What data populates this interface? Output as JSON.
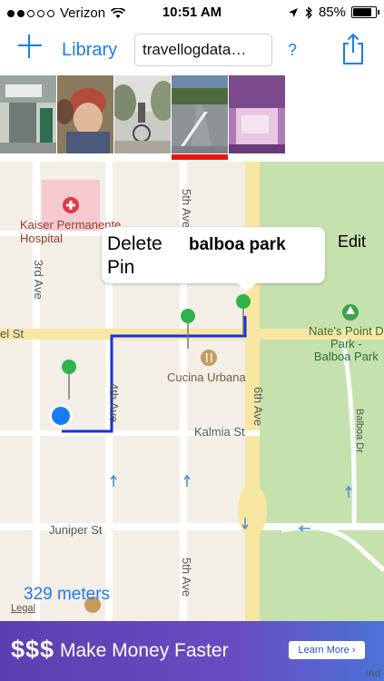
{
  "status": {
    "carrier": "Verizon",
    "time": "10:51 AM",
    "battery": "85%",
    "battery_level": 0.85,
    "signal_bars_filled": 2
  },
  "toolbar": {
    "library_label": "Library",
    "search_value": "travellogdata…",
    "help_label": "?"
  },
  "thumbnails": [
    {
      "name": "hospital-photo"
    },
    {
      "name": "child-photo"
    },
    {
      "name": "cyclist-photo"
    },
    {
      "name": "road-photo",
      "selected": true
    },
    {
      "name": "room-photo"
    }
  ],
  "map": {
    "labels": {
      "hospital": "Kaiser Permanente\nHospital",
      "third_ave": "3rd Ave",
      "fourth_ave": "4th Ave",
      "fifth_ave": "5th Ave",
      "sixth_ave": "6th Ave",
      "fifth_ave_top": "5th Ave",
      "laurel_st": "el St",
      "kalmia_st": "Kalmia St",
      "juniper_st": "Juniper St",
      "cucina": "Cucina Urbana",
      "natespoint": "Nate's Point D\nPark -\nBalboa Park",
      "balboa_dr": "Balboa Dr"
    },
    "callout": {
      "delete_label": "Delete\nPin",
      "title": "balboa park",
      "edit_label": "Edit"
    },
    "scale_label": "329 meters",
    "legal_label": "Legal"
  },
  "ad": {
    "dollars": "$$$",
    "headline": "Make Money Faster",
    "button": "Learn More ›",
    "badge": "iAd"
  },
  "colors": {
    "accent": "#1a7cf5",
    "selected_bar": "#e8150f",
    "route": "#1a2ee0",
    "pin": "#2fb34a"
  }
}
